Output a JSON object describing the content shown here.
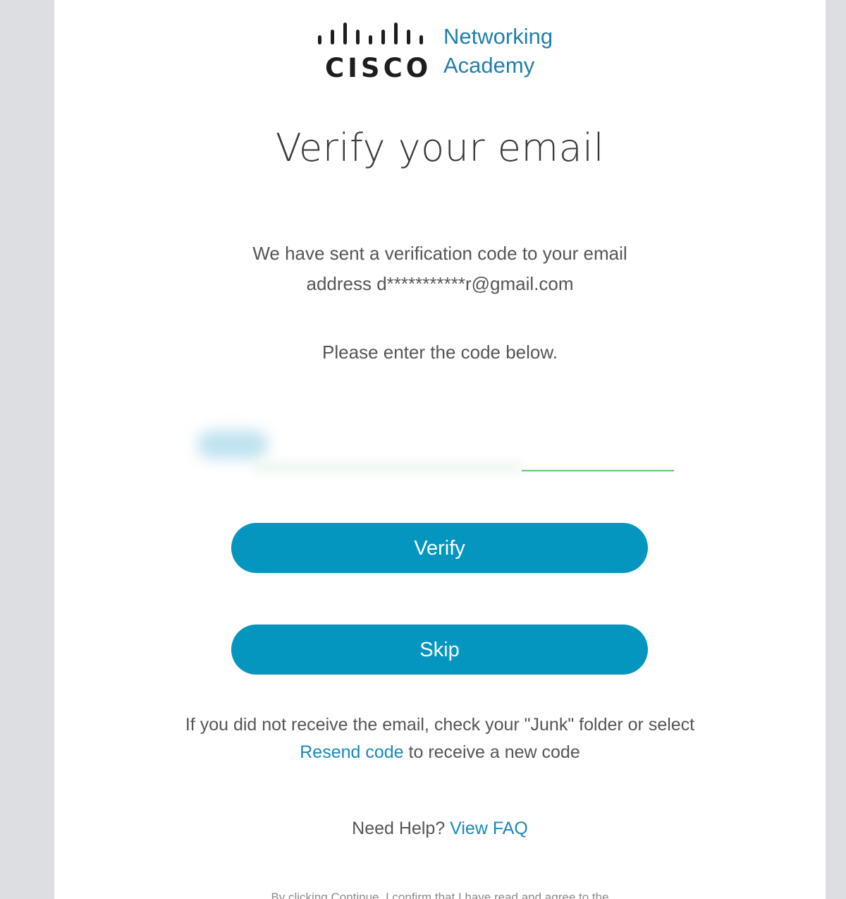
{
  "logo": {
    "wordmark": "CISCO",
    "academy_line1": "Networking",
    "academy_line2": "Academy",
    "brand_color": "#1f7fac"
  },
  "title": "Verify your email",
  "message": {
    "line1": "We have sent a verification code to your email",
    "line2": "address d***********r@gmail.com"
  },
  "instruction": "Please enter the code below.",
  "code_input": {
    "value": "",
    "placeholder": ""
  },
  "buttons": {
    "verify_label": "Verify",
    "skip_label": "Skip",
    "color": "#0496bf"
  },
  "help": {
    "line1": "If you did not receive the email, check your \"Junk\" folder or select",
    "resend_link": "Resend code",
    "line2_suffix": " to receive a new code"
  },
  "faq": {
    "prefix": "Need Help? ",
    "link": "View FAQ"
  },
  "disclaimer": "By clicking Continue, I confirm that I have read and agree to the"
}
